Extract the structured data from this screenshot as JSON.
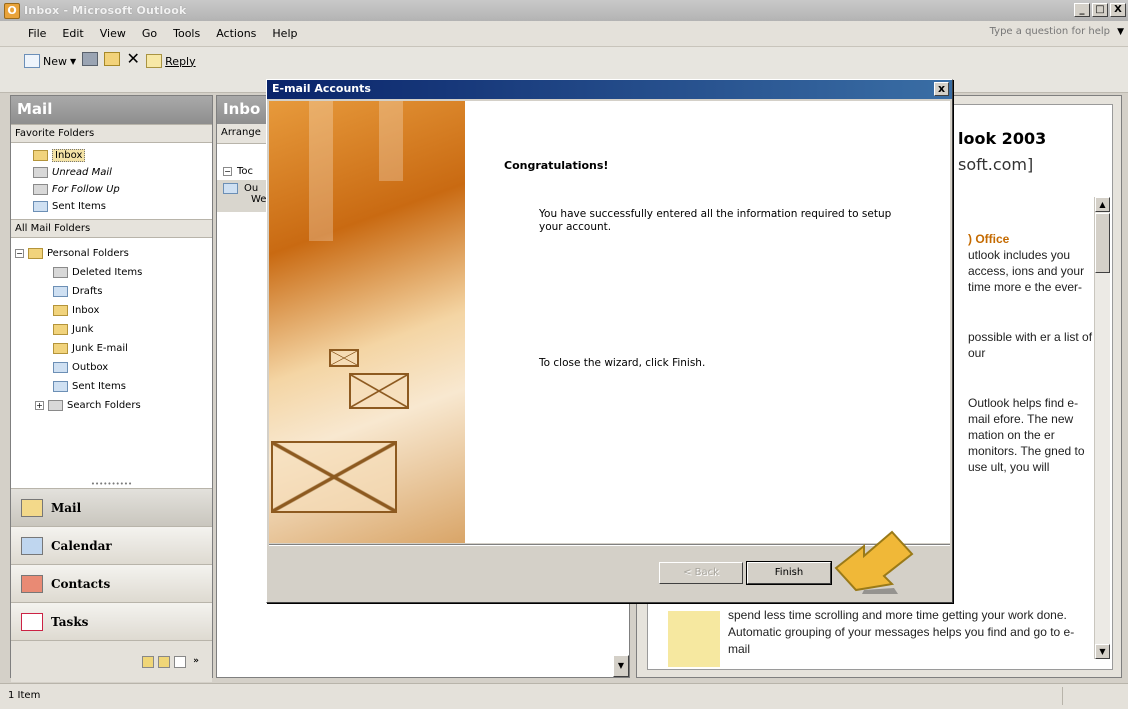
{
  "window": {
    "title": "Inbox - Microsoft Outlook",
    "icon": "outlook-icon",
    "controls": [
      "_",
      "□",
      "X"
    ]
  },
  "menu": {
    "items": [
      "File",
      "Edit",
      "View",
      "Go",
      "Tools",
      "Actions",
      "Help"
    ],
    "help_placeholder": "Type a question for help"
  },
  "toolbar": {
    "new_label": "New",
    "reply_label": "Reply"
  },
  "nav": {
    "header": "Mail",
    "favorites_label": "Favorite Folders",
    "favorites": [
      "Inbox",
      "Unread Mail",
      "For Follow Up",
      "Sent Items"
    ],
    "all_folders_label": "All Mail Folders",
    "root": "Personal Folders",
    "folders": [
      "Deleted Items",
      "Drafts",
      "Inbox",
      "Junk",
      "Junk E-mail",
      "Outbox",
      "Sent Items"
    ],
    "search_folders": "Search Folders",
    "buttons": [
      "Mail",
      "Calendar",
      "Contacts",
      "Tasks"
    ]
  },
  "inbox": {
    "header": "Inbo",
    "arrange": "Arrange",
    "group": "Toc",
    "message_from": "Ou",
    "message_sub": "We"
  },
  "reading": {
    "title": "look 2003",
    "subtitle": "soft.com]",
    "heading": ") Office",
    "para1": "utlook includes you access, ions and your time more e the ever-",
    "para2": "possible with er a list of our",
    "para3": "Outlook helps find e-mail efore. The new mation on the er monitors. The gned to use ult, you will",
    "bottom": "spend less time scrolling and more time getting your work done. Automatic grouping of your messages helps you find and go to e-mail"
  },
  "dialog": {
    "title": "E-mail Accounts",
    "close": "x",
    "heading": "Congratulations!",
    "message1": "You have successfully entered all the information required to setup your account.",
    "message2": "To close the wizard, click Finish.",
    "back_label": "< Back",
    "finish_label": "Finish"
  },
  "status": {
    "text": "1 Item"
  },
  "colors": {
    "dialog_title_start": "#0a246a",
    "dialog_title_end": "#3a6ea5",
    "arrow": "#f0b838"
  }
}
